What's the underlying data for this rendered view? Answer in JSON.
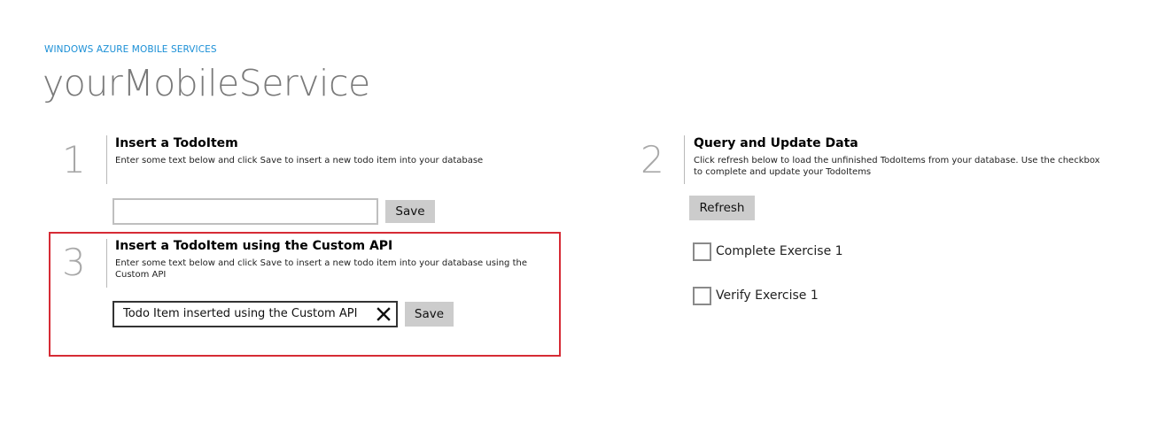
{
  "header": {
    "app_caption": "WINDOWS AZURE MOBILE SERVICES",
    "title": "yourMobileService"
  },
  "section_insert": {
    "number": "1",
    "title": "Insert a TodoItem",
    "description": "Enter some text below and click Save to insert a new todo item into your database",
    "input_value": "",
    "save_label": "Save"
  },
  "section_query": {
    "number": "2",
    "title": "Query and Update Data",
    "description": "Click refresh below to load the unfinished TodoItems from your database. Use the checkbox to complete and update your TodoItems",
    "refresh_label": "Refresh",
    "items": [
      {
        "label": "Complete Exercise 1",
        "checked": false
      },
      {
        "label": "Verify Exercise 1",
        "checked": false
      }
    ]
  },
  "section_custom_api": {
    "number": "3",
    "title": "Insert a TodoItem using the Custom API",
    "description": "Enter some text below and click Save to insert a new todo item into your database using the Custom API",
    "input_value": "Todo Item inserted using the Custom API",
    "clear_icon": "close-icon",
    "save_label": "Save"
  },
  "colors": {
    "accent": "#1a8fd6",
    "highlight_border": "#d62b35",
    "button_bg": "#cccccc",
    "muted_text": "#a8a8a8"
  }
}
